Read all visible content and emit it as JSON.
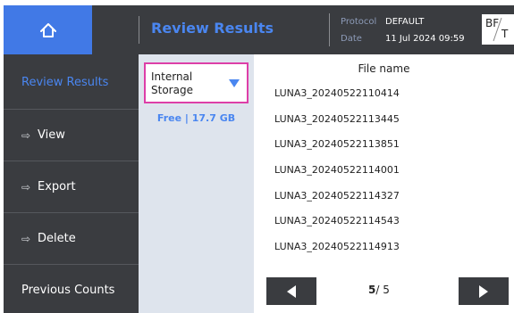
{
  "header": {
    "title": "Review Results",
    "protocol_key": "Protocol",
    "protocol_value": "DEFAULT",
    "date_key": "Date",
    "date_value": "11 Jul 2024 09:59",
    "badge_top": "BF",
    "badge_bottom": "T"
  },
  "sidebar": {
    "items": [
      {
        "label": "Review Results"
      },
      {
        "label": "View"
      },
      {
        "label": "Export"
      },
      {
        "label": "Delete"
      },
      {
        "label": "Previous Counts"
      }
    ]
  },
  "storage": {
    "selected_line1": "Internal",
    "selected_line2": "Storage",
    "free": "Free | 17.7 GB"
  },
  "files": {
    "header": "File name",
    "rows": [
      "LUNA3_20240522110414",
      "LUNA3_20240522113445",
      "LUNA3_20240522113851",
      "LUNA3_20240522114001",
      "LUNA3_20240522114327",
      "LUNA3_20240522114543",
      "LUNA3_20240522114913"
    ]
  },
  "pagination": {
    "current": "5",
    "total": "/ 5"
  },
  "colors": {
    "accent": "#4a86f0",
    "header_bg": "#3a3c40",
    "highlight_border": "#dd3fa8"
  }
}
